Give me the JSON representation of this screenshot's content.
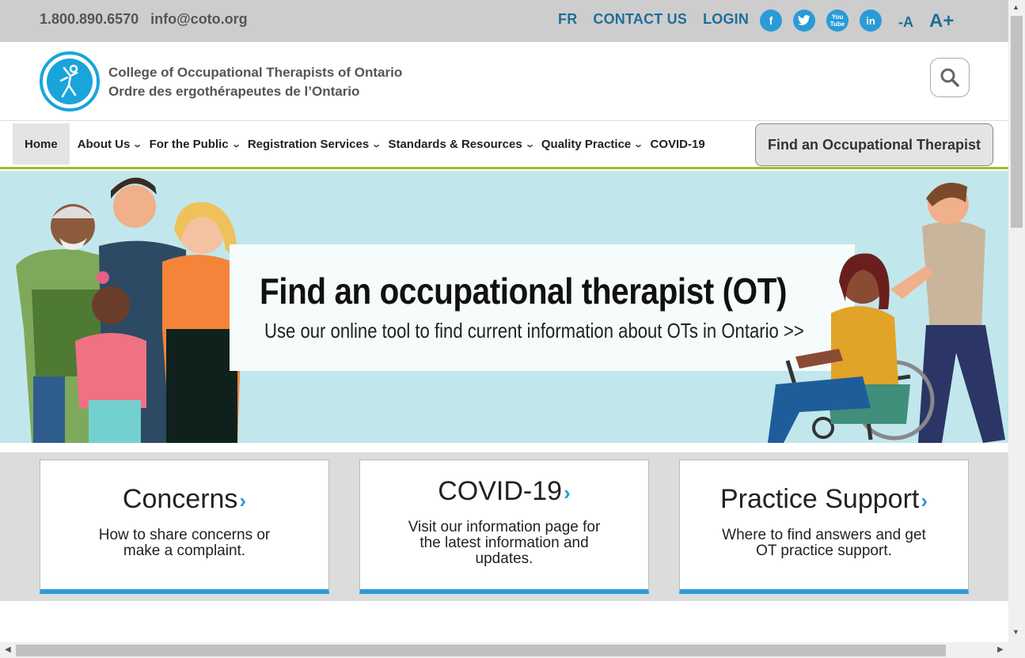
{
  "topbar": {
    "phone": "1.800.890.6570",
    "email": "info@coto.org",
    "links": [
      "FR",
      "CONTACT US",
      "LOGIN"
    ],
    "social": [
      {
        "icon": "facebook-icon",
        "glyph": "f"
      },
      {
        "icon": "twitter-icon",
        "glyph": "t"
      },
      {
        "icon": "youtube-icon",
        "glyph": "You Tube"
      },
      {
        "icon": "linkedin-icon",
        "glyph": "in"
      }
    ],
    "font_decrease": "-A",
    "font_increase": "A+"
  },
  "header": {
    "org_name_en": "College of Occupational Therapists of Ontario",
    "org_name_fr": "Ordre des ergothérapeutes de l’Ontario"
  },
  "nav": {
    "items": [
      {
        "label": "Home",
        "dropdown": false
      },
      {
        "label": "About Us",
        "dropdown": true
      },
      {
        "label": "For the Public",
        "dropdown": true
      },
      {
        "label": "Registration Services",
        "dropdown": true
      },
      {
        "label": "Standards & Resources",
        "dropdown": true
      },
      {
        "label": "Quality Practice",
        "dropdown": true
      },
      {
        "label": "COVID-19",
        "dropdown": false
      }
    ],
    "cta": "Find an Occupational Therapist"
  },
  "hero": {
    "title": "Find an occupational therapist (OT)",
    "subtitle": "Use our online tool to find current information about OTs in Ontario  >>"
  },
  "cards": [
    {
      "title": "Concerns",
      "desc": "How to share concerns or make a complaint."
    },
    {
      "title": "COVID-19",
      "desc": "Visit our information page for the latest information and updates."
    },
    {
      "title": "Practice Support",
      "desc": "Where to find answers and get OT practice support."
    }
  ],
  "colors": {
    "accent_blue": "#2a9bd7",
    "link_blue": "#1e6e9a",
    "nav_underline": "#9bbf2a",
    "hero_bg": "#c1e7ec"
  }
}
